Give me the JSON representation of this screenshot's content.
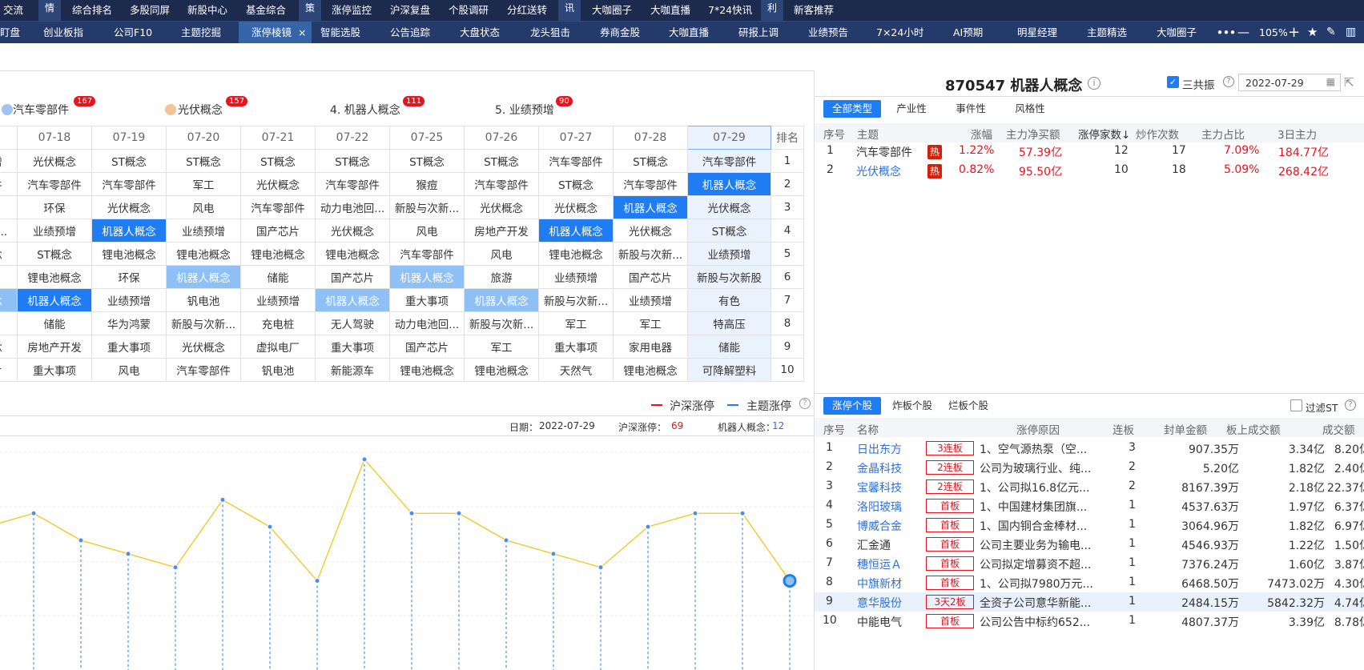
{
  "nav1": {
    "items": [
      "交流",
      "综合排名",
      "多股同屏",
      "新股中心",
      "基金综合",
      "涨停监控",
      "沪深复盘",
      "个股调研",
      "分红送转",
      "大咖圈子",
      "大咖直播",
      "7*24快讯",
      "新客推荐"
    ],
    "tags": [
      "情",
      "策",
      "讯",
      "利"
    ]
  },
  "nav2": {
    "items": [
      "盯盘",
      "创业板指",
      "公司F10",
      "主题挖掘",
      "涨停棱镜",
      "智能选股",
      "公告追踪",
      "大盘状态",
      "龙头狙击",
      "券商金股",
      "大咖直播",
      "研报上调",
      "业绩预告",
      "7×24小时",
      "AI预期",
      "明星经理",
      "主题精选",
      "大咖圈子"
    ],
    "zoom": "105%",
    "close": "×"
  },
  "top_cats": [
    {
      "label": "汽车零部件",
      "count": "167"
    },
    {
      "label": "光伏概念",
      "count": "157"
    },
    {
      "label": "4. 机器人概念",
      "count": "111"
    },
    {
      "label": "5. 业绩预增",
      "count": "90"
    }
  ],
  "grid": {
    "dates": [
      "",
      "07-18",
      "07-19",
      "07-20",
      "07-21",
      "07-22",
      "07-25",
      "07-26",
      "07-27",
      "07-28",
      "07-29"
    ],
    "rank_header": "排名",
    "rows": [
      [
        "增",
        "光伏概念",
        "ST概念",
        "ST概念",
        "ST概念",
        "ST概念",
        "ST概念",
        "ST概念",
        "汽车零部件",
        "ST概念",
        "汽车零部件",
        "1"
      ],
      [
        "件",
        "汽车零部件",
        "汽车零部件",
        "汽车零部件",
        "军工",
        "光伏概念",
        "汽车零部件",
        "猴痘",
        "汽车零部件",
        "ST概念",
        "汽车零部件",
        "机器人概念",
        "2"
      ],
      [
        "",
        "环保",
        "光伏概念",
        "风电",
        "汽车零部件",
        "动力电池回...",
        "新股与次新...",
        "光伏概念",
        "光伏概念",
        "机器人概念",
        "光伏概念",
        "3"
      ],
      [
        "新...",
        "业绩预增",
        "机器人概念",
        "业绩预增",
        "国产芯片",
        "光伏概念",
        "风电",
        "房地产开发",
        "机器人概念",
        "光伏概念",
        "ST概念",
        "4"
      ],
      [
        "念",
        "ST概念",
        "锂电池概念",
        "锂电池概念",
        "锂电池概念",
        "锂电池概念",
        "汽车零部件",
        "风电",
        "锂电池概念",
        "新股与次新...",
        "业绩预增",
        "5"
      ],
      [
        "",
        "锂电池概念",
        "环保",
        "机器人概念",
        "储能",
        "国产芯片",
        "机器人概念",
        "旅游",
        "业绩预增",
        "国产芯片",
        "新股与次新股",
        "6"
      ],
      [
        "念",
        "机器人概念",
        "业绩预增",
        "钒电池",
        "业绩预增",
        "机器人概念",
        "重大事项",
        "机器人概念",
        "新股与次新...",
        "业绩预增",
        "有色",
        "7"
      ],
      [
        "",
        "储能",
        "华为鸿蒙",
        "新股与次新...",
        "充电桩",
        "无人驾驶",
        "动力电池回...",
        "新股与次新...",
        "军工",
        "军工",
        "特高压",
        "8"
      ],
      [
        "念",
        "房地产开发",
        "重大事项",
        "光伏概念",
        "虚拟电厂",
        "重大事项",
        "国产芯片",
        "军工",
        "重大事项",
        "家用电器",
        "储能",
        "9"
      ],
      [
        "片",
        "重大事项",
        "风电",
        "汽车零部件",
        "钒电池",
        "新能源车",
        "锂电池概念",
        "锂电池概念",
        "天然气",
        "锂电池概念",
        "可降解塑料",
        "10"
      ]
    ]
  },
  "legend": {
    "a": "沪深涨停",
    "b": "主题涨停"
  },
  "info": {
    "date_label": "日期：",
    "date": "2022-07-29",
    "hs_label": "沪深涨停：",
    "hs": "69",
    "theme_label": "机器人概念：",
    "theme": "12"
  },
  "chart_data": {
    "type": "line",
    "series": [
      {
        "name": "主题涨停",
        "values": [
          8,
          9,
          7,
          6,
          5,
          10,
          8,
          4,
          13,
          9,
          9,
          7,
          6,
          5,
          8,
          9,
          9,
          4
        ]
      }
    ],
    "ylim": [
      0,
      14
    ],
    "colors": {
      "line": "#f5c518",
      "drop": "#1f7cf2",
      "end": "#1f7cf2"
    }
  },
  "right": {
    "code_title": "870547 机器人概念",
    "resonance": "三共振",
    "date_input": "2022-07-29",
    "tabs": [
      "全部类型",
      "产业性",
      "事件性",
      "风格性"
    ],
    "headers": [
      "序号",
      "主题",
      "涨幅",
      "主力净买额",
      "涨停家数↓",
      "炒作次数",
      "主力占比",
      "3日主力"
    ],
    "hot": "热",
    "rows": [
      {
        "no": "1",
        "name": "汽车零部件",
        "chg": "1.22%",
        "net": "57.39亿",
        "up": "12",
        "times": "17",
        "ratio": "7.09%",
        "d3": "184.77亿"
      },
      {
        "no": "2",
        "name": "光伏概念",
        "chg": "0.82%",
        "net": "95.50亿",
        "up": "10",
        "times": "18",
        "ratio": "5.09%",
        "d3": "268.42亿"
      }
    ]
  },
  "stocks": {
    "tabs": [
      "涨停个股",
      "炸板个股",
      "烂板个股"
    ],
    "filter": "过滤ST",
    "headers": [
      "序号",
      "名称",
      "涨停原因",
      "连板",
      "封单金额",
      "板上成交额",
      "成交额"
    ],
    "rows": [
      {
        "no": "1",
        "name": "日出东方",
        "tag": "3连板",
        "reason": "1、空气源热泵（空...",
        "lb": "3",
        "seal": "907.35万",
        "amt": "3.34亿",
        "vol": "8.20亿"
      },
      {
        "no": "2",
        "name": "金晶科技",
        "tag": "2连板",
        "reason": "公司为玻璃行业、纯...",
        "lb": "2",
        "seal": "5.20亿",
        "amt": "1.82亿",
        "vol": "2.40亿"
      },
      {
        "no": "3",
        "name": "宝馨科技",
        "tag": "2连板",
        "reason": "1、公司拟16.8亿元...",
        "lb": "2",
        "seal": "8167.39万",
        "amt": "2.18亿",
        "vol": "22.37亿"
      },
      {
        "no": "4",
        "name": "洛阳玻璃",
        "tag": "首板",
        "reason": "1、中国建材集团旗...",
        "lb": "1",
        "seal": "4537.63万",
        "amt": "1.97亿",
        "vol": "6.37亿"
      },
      {
        "no": "5",
        "name": "博威合金",
        "tag": "首板",
        "reason": "1、国内铜合金棒材...",
        "lb": "1",
        "seal": "3064.96万",
        "amt": "1.82亿",
        "vol": "6.97亿"
      },
      {
        "no": "6",
        "name": "汇金通",
        "tag": "首板",
        "reason": "公司主要业务为输电...",
        "lb": "1",
        "seal": "4546.93万",
        "amt": "1.22亿",
        "vol": "1.50亿"
      },
      {
        "no": "7",
        "name": "穗恒运Ａ",
        "tag": "首板",
        "reason": "公司拟定增募资不超...",
        "lb": "1",
        "seal": "7376.24万",
        "amt": "1.60亿",
        "vol": "3.87亿"
      },
      {
        "no": "8",
        "name": "中旗新材",
        "tag": "首板",
        "reason": "1、公司拟7980万元...",
        "lb": "1",
        "seal": "6468.50万",
        "amt": "7473.02万",
        "vol": "4.30亿"
      },
      {
        "no": "9",
        "name": "意华股份",
        "tag": "3天2板",
        "reason": "全资子公司意华新能...",
        "lb": "1",
        "seal": "2484.15万",
        "amt": "5842.32万",
        "vol": "4.74亿"
      },
      {
        "no": "10",
        "name": "中能电气",
        "tag": "首板",
        "reason": "公司公告中标约652...",
        "lb": "1",
        "seal": "4807.37万",
        "amt": "3.39亿",
        "vol": "8.78亿"
      }
    ]
  }
}
